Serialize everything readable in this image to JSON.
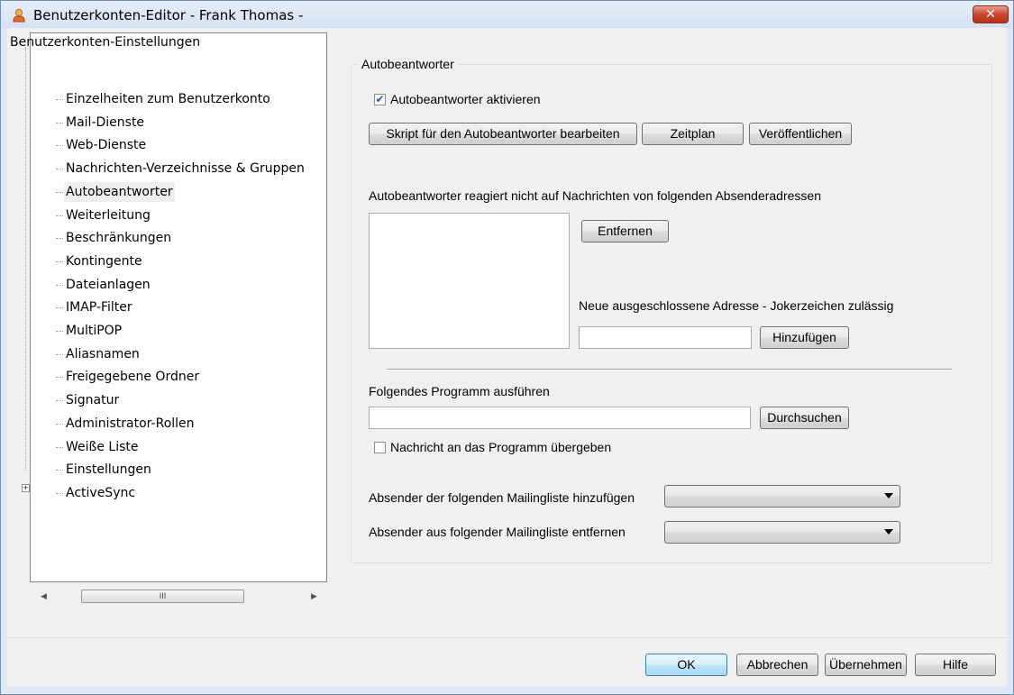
{
  "window": {
    "title": "Benutzerkonten-Editor - Frank Thomas -",
    "close_label": "✕"
  },
  "sidebar": {
    "root": "Benutzerkonten-Einstellungen",
    "items": [
      {
        "label": "Einzelheiten zum Benutzerkonto"
      },
      {
        "label": "Mail-Dienste"
      },
      {
        "label": "Web-Dienste"
      },
      {
        "label": "Nachrichten-Verzeichnisse & Gruppen"
      },
      {
        "label": "Autobeantworter",
        "selected": true
      },
      {
        "label": "Weiterleitung"
      },
      {
        "label": "Beschränkungen"
      },
      {
        "label": "Kontingente"
      },
      {
        "label": "Dateianlagen"
      },
      {
        "label": "IMAP-Filter"
      },
      {
        "label": "MultiPOP"
      },
      {
        "label": "Aliasnamen"
      },
      {
        "label": "Freigegebene Ordner"
      },
      {
        "label": "Signatur"
      },
      {
        "label": "Administrator-Rollen"
      },
      {
        "label": "Weiße Liste"
      },
      {
        "label": "Einstellungen"
      },
      {
        "label": "ActiveSync",
        "expandable": true
      }
    ],
    "scroll_left": "◀",
    "scroll_right": "▶",
    "scroll_grip": "III"
  },
  "autoresponder": {
    "group_title": "Autobeantworter",
    "enable_label": "Autobeantworter aktivieren",
    "enable_checked": true,
    "edit_script_button": "Skript für den Autobeantworter bearbeiten",
    "schedule_button": "Zeitplan",
    "publish_button": "Veröffentlichen",
    "exclusion_label": "Autobeantworter reagiert nicht auf Nachrichten von folgenden Absenderadressen",
    "remove_button": "Entfernen",
    "new_exclusion_label": "Neue ausgeschlossene Adresse - Jokerzeichen zulässig",
    "new_exclusion_value": "",
    "add_button": "Hinzufügen",
    "program_label": "Folgendes Programm ausführen",
    "program_value": "",
    "browse_button": "Durchsuchen",
    "pass_message_label": "Nachricht an das Programm übergeben",
    "pass_message_checked": false,
    "add_to_list_label": "Absender der folgenden Mailingliste hinzufügen",
    "add_to_list_value": "",
    "remove_from_list_label": "Absender aus folgender Mailingliste entfernen",
    "remove_from_list_value": ""
  },
  "footer": {
    "ok": "OK",
    "cancel": "Abbrechen",
    "apply": "Übernehmen",
    "help": "Hilfe"
  }
}
